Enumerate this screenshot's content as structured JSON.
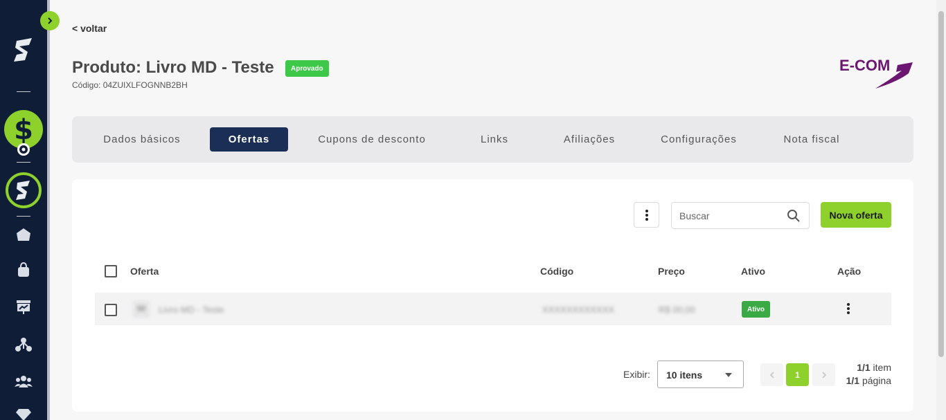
{
  "header": {
    "back_label": "< voltar",
    "title": "Produto: Livro MD - Teste",
    "status": "Aprovado",
    "code": "Código: 04ZUIXLFOGNNB2BH",
    "brand": "E-COM"
  },
  "tabs": [
    {
      "label": "Dados básicos"
    },
    {
      "label": "Ofertas"
    },
    {
      "label": "Cupons de desconto"
    },
    {
      "label": "Links"
    },
    {
      "label": "Afiliações"
    },
    {
      "label": "Configurações"
    },
    {
      "label": "Nota fiscal"
    }
  ],
  "toolbar": {
    "search_placeholder": "Buscar",
    "new_offer_label": "Nova oferta"
  },
  "table": {
    "columns": [
      "Oferta",
      "Código",
      "Preço",
      "Ativo",
      "Ação"
    ],
    "rows": [
      {
        "offer": "Livro MD - Teste",
        "code": "XXXXXXXXXXXX",
        "price": "R$ 00,00",
        "active": "Ativo"
      }
    ]
  },
  "pagination": {
    "show_label": "Exibir:",
    "page_size": "10 itens",
    "current_page": "1",
    "items_count": "1/1",
    "items_word": "item",
    "pages_count": "1/1",
    "pages_word": "página"
  },
  "colors": {
    "sidebar": "#0f1d37",
    "accent": "#8fd12c",
    "active_tab": "#1b2e55",
    "status_green": "#3ec84a",
    "brand_purple": "#6b1670"
  }
}
